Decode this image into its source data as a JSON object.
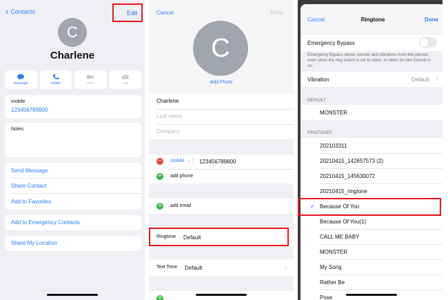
{
  "contact_view": {
    "back_label": "Contacts",
    "edit_label": "Edit",
    "avatar_initial": "C",
    "name": "Charlene",
    "actions": [
      {
        "label": "message",
        "icon": "message-icon",
        "enabled": true
      },
      {
        "label": "mobile",
        "icon": "phone-icon",
        "enabled": true
      },
      {
        "label": "video",
        "icon": "video-icon",
        "enabled": false
      },
      {
        "label": "mail",
        "icon": "mail-icon",
        "enabled": false
      }
    ],
    "phone_label": "mobile",
    "phone_value": "123456789800",
    "notes_label": "Notes",
    "links": [
      "Send Message",
      "Share Contact",
      "Add to Favorites"
    ],
    "emergency_link": "Add to Emergency Contacts",
    "location_link": "Share My Location"
  },
  "edit_view": {
    "cancel_label": "Cancel",
    "done_label": "Done",
    "avatar_initial": "C",
    "add_photo_label": "Add Photo",
    "first_name": "Charlene",
    "last_name_placeholder": "Last name",
    "company_placeholder": "Company",
    "phone_type": "mobile",
    "phone_number": "123456789800",
    "add_phone_label": "add phone",
    "add_email_label": "add email",
    "ringtone_label": "Ringtone",
    "ringtone_value": "Default",
    "text_tone_label": "Text Tone",
    "text_tone_value": "Default"
  },
  "ringtone_view": {
    "cancel_label": "Cancel",
    "title": "Ringtone",
    "done_label": "Done",
    "emergency_bypass_label": "Emergency Bypass",
    "emergency_bypass_on": false,
    "emergency_bypass_note": "Emergency Bypass allows sounds and vibrations from this person even when the ring switch is set to silent, or when Do Not Disturb is on.",
    "vibration_label": "Vibration",
    "vibration_value": "Default",
    "default_header": "DEFAULT",
    "default_tone": "MONSTER",
    "ringtones_header": "RINGTONES",
    "ringtones": [
      "202103311",
      "20210415_142657573 (2)",
      "20210415_145630072",
      "20210415_ringtone",
      "Because Of You",
      "Because Of You(1)",
      "CALL ME BABY",
      "MONSTER",
      "My Song",
      "Rather Be",
      "Pose"
    ],
    "selected_ringtone": "Because Of You"
  },
  "colors": {
    "accent": "#2f7cf6",
    "highlight": "#e8141f",
    "delete": "#e8453c",
    "add": "#3cb64c"
  }
}
